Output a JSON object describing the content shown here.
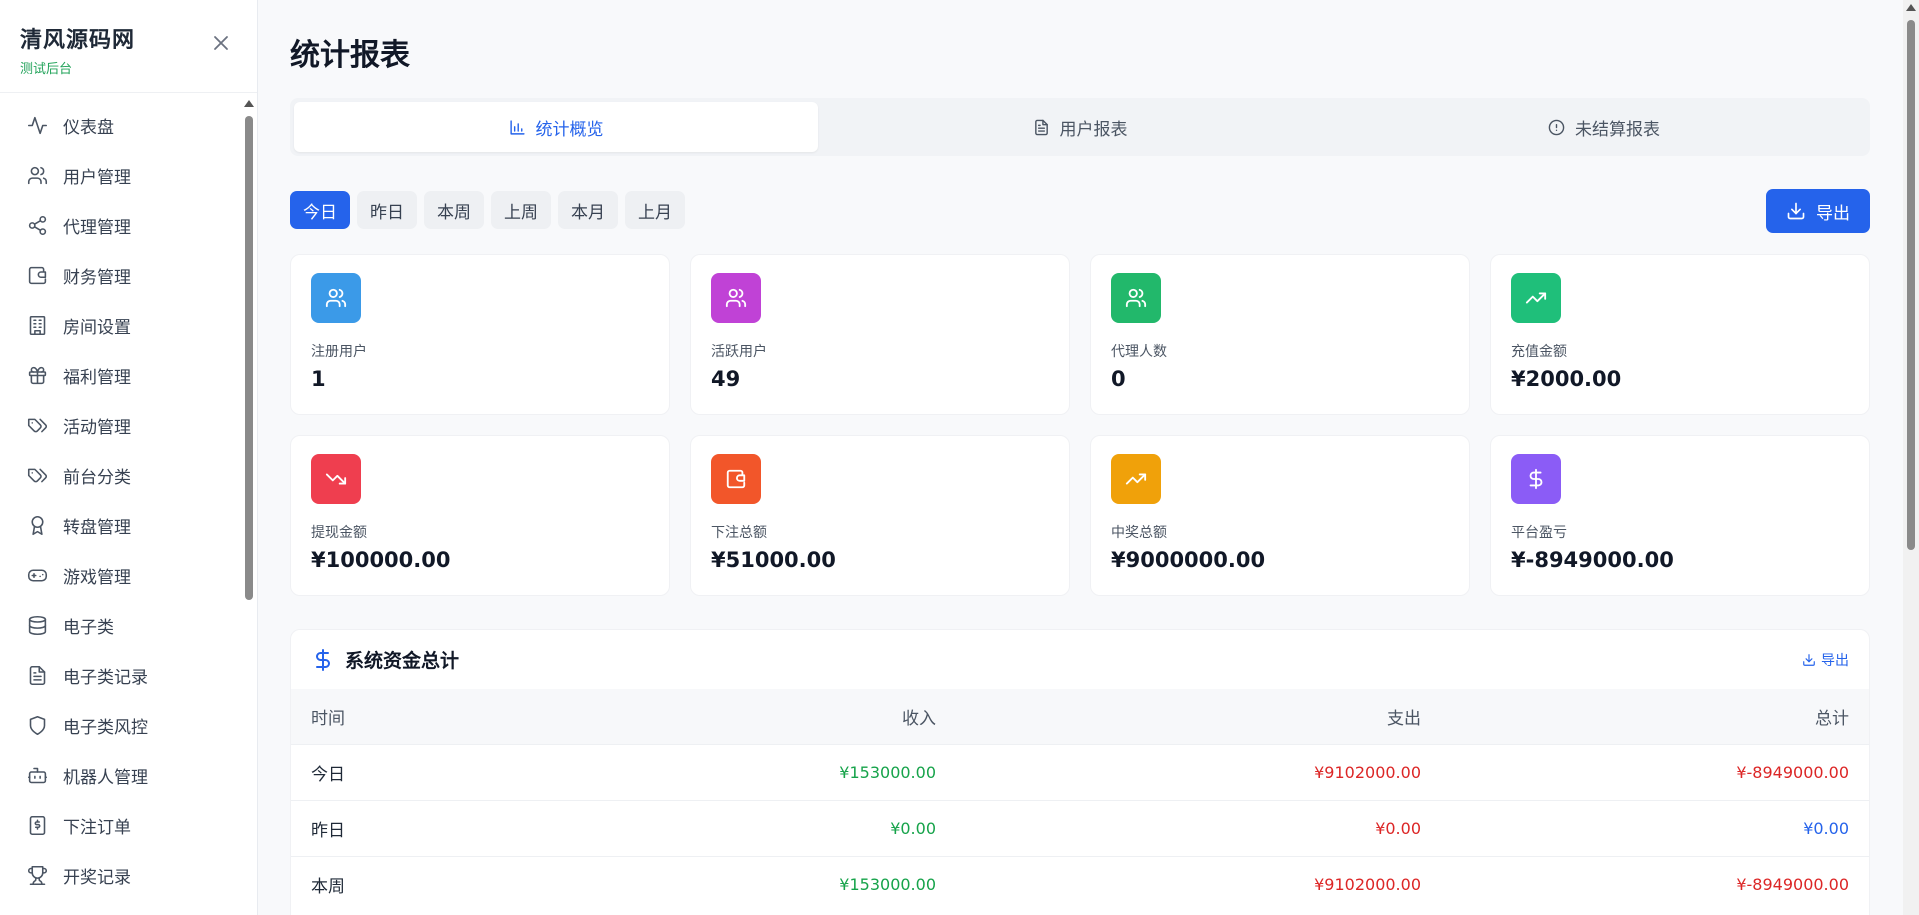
{
  "brand": {
    "title": "清风源码网",
    "subtitle": "测试后台"
  },
  "sidebar": {
    "items": [
      {
        "label": "仪表盘",
        "icon": "activity-icon"
      },
      {
        "label": "用户管理",
        "icon": "users-icon"
      },
      {
        "label": "代理管理",
        "icon": "share-icon"
      },
      {
        "label": "财务管理",
        "icon": "wallet-icon"
      },
      {
        "label": "房间设置",
        "icon": "building-icon"
      },
      {
        "label": "福利管理",
        "icon": "gift-icon"
      },
      {
        "label": "活动管理",
        "icon": "tags-icon"
      },
      {
        "label": "前台分类",
        "icon": "tag-icon"
      },
      {
        "label": "转盘管理",
        "icon": "award-icon"
      },
      {
        "label": "游戏管理",
        "icon": "gamepad-icon"
      },
      {
        "label": "电子类",
        "icon": "database-icon"
      },
      {
        "label": "电子类记录",
        "icon": "file-text-icon"
      },
      {
        "label": "电子类风控",
        "icon": "shield-icon"
      },
      {
        "label": "机器人管理",
        "icon": "bot-icon"
      },
      {
        "label": "下注订单",
        "icon": "receipt-icon"
      },
      {
        "label": "开奖记录",
        "icon": "trophy-icon"
      }
    ]
  },
  "page": {
    "title": "统计报表"
  },
  "tabs": [
    {
      "label": "统计概览",
      "icon": "bar-chart-icon",
      "active": true
    },
    {
      "label": "用户报表",
      "icon": "file-text-icon",
      "active": false
    },
    {
      "label": "未结算报表",
      "icon": "alert-circle-icon",
      "active": false
    }
  ],
  "periods": [
    {
      "label": "今日",
      "active": true
    },
    {
      "label": "昨日",
      "active": false
    },
    {
      "label": "本周",
      "active": false
    },
    {
      "label": "上周",
      "active": false
    },
    {
      "label": "本月",
      "active": false
    },
    {
      "label": "上月",
      "active": false
    }
  ],
  "export_label": "导出",
  "stats": [
    {
      "label": "注册用户",
      "value": "1",
      "icon": "users-icon",
      "color": "#3b9ae8"
    },
    {
      "label": "活跃用户",
      "value": "49",
      "icon": "users-icon",
      "color": "#c042d6"
    },
    {
      "label": "代理人数",
      "value": "0",
      "icon": "users-icon",
      "color": "#22b86b"
    },
    {
      "label": "充值金额",
      "value": "¥2000.00",
      "icon": "trending-up-icon",
      "color": "#1fbf7a"
    },
    {
      "label": "提现金额",
      "value": "¥100000.00",
      "icon": "trending-down-icon",
      "color": "#ef3e4f"
    },
    {
      "label": "下注总额",
      "value": "¥51000.00",
      "icon": "wallet-icon",
      "color": "#f2562a"
    },
    {
      "label": "中奖总额",
      "value": "¥9000000.00",
      "icon": "trending-up-icon",
      "color": "#f0a10a"
    },
    {
      "label": "平台盈亏",
      "value": "¥-8949000.00",
      "icon": "dollar-icon",
      "color": "#8b5cf6"
    }
  ],
  "funds": {
    "title": "系统资金总计",
    "export_label": "导出",
    "columns": [
      "时间",
      "收入",
      "支出",
      "总计"
    ],
    "rows": [
      {
        "time": "今日",
        "income": "¥153000.00",
        "expense": "¥9102000.00",
        "total": "¥-8949000.00",
        "total_tone": "neg"
      },
      {
        "time": "昨日",
        "income": "¥0.00",
        "expense": "¥0.00",
        "total": "¥0.00",
        "total_tone": "blue"
      },
      {
        "time": "本周",
        "income": "¥153000.00",
        "expense": "¥9102000.00",
        "total": "¥-8949000.00",
        "total_tone": "neg"
      }
    ]
  }
}
